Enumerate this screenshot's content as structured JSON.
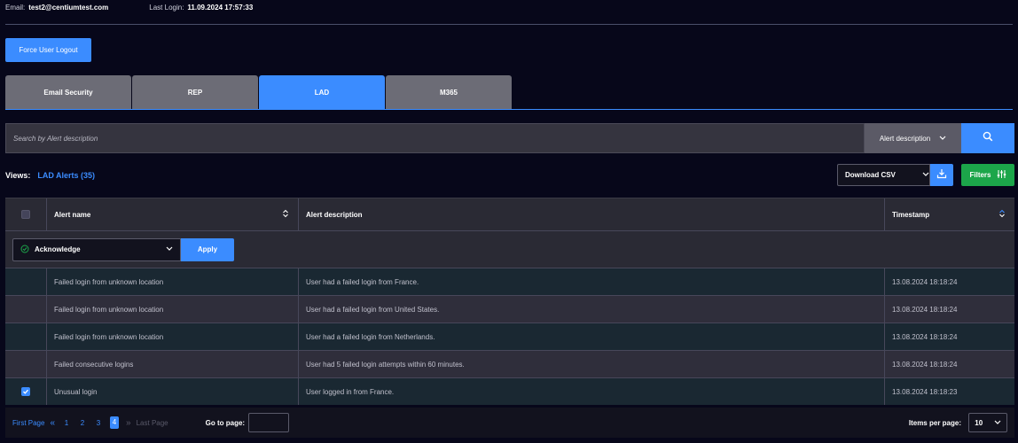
{
  "header": {
    "email_label": "Email:",
    "email_value": "test2@centiumtest.com",
    "last_login_label": "Last Login:",
    "last_login_value": "11.09.2024  17:57:33"
  },
  "actions": {
    "force_logout_label": "Force User Logout"
  },
  "tabs": [
    {
      "label": "Email Security",
      "active": false
    },
    {
      "label": "REP",
      "active": false
    },
    {
      "label": "LAD",
      "active": true
    },
    {
      "label": "M365",
      "active": false
    }
  ],
  "search": {
    "placeholder": "Search by Alert description",
    "field_selected": "Alert description"
  },
  "views": {
    "label": "Views:",
    "current": "LAD Alerts (35)"
  },
  "toolbar": {
    "download_label": "Download CSV",
    "filters_label": "Filters"
  },
  "table": {
    "columns": [
      "Alert name",
      "Alert description",
      "Timestamp"
    ],
    "bulk_action": {
      "selected": "Acknowledge",
      "apply_label": "Apply"
    },
    "rows": [
      {
        "name": "Failed login from unknown location",
        "description": "User had a failed login from France.",
        "timestamp": "13.08.2024  18:18:24",
        "checked": false
      },
      {
        "name": "Failed login from unknown location",
        "description": "User had a failed login from United States.",
        "timestamp": "13.08.2024  18:18:24",
        "checked": false
      },
      {
        "name": "Failed login from unknown location",
        "description": "User had a failed login from Netherlands.",
        "timestamp": "13.08.2024  18:18:24",
        "checked": false
      },
      {
        "name": "Failed consecutive logins",
        "description": "User had 5 failed login attempts within 60 minutes.",
        "timestamp": "13.08.2024  18:18:24",
        "checked": false
      },
      {
        "name": "Unusual login",
        "description": "User logged in from France.",
        "timestamp": "13.08.2024  18:18:23",
        "checked": true
      }
    ]
  },
  "pagination": {
    "first_label": "First Page",
    "last_label": "Last Page",
    "pages": [
      "1",
      "2",
      "3",
      "4"
    ],
    "current_page": "4",
    "goto_label": "Go to page:",
    "items_per_page_label": "Items per page:",
    "items_per_page_value": "10"
  },
  "colors": {
    "accent": "#3b8cff",
    "filters": "#1ca64a",
    "background": "#07071a"
  }
}
